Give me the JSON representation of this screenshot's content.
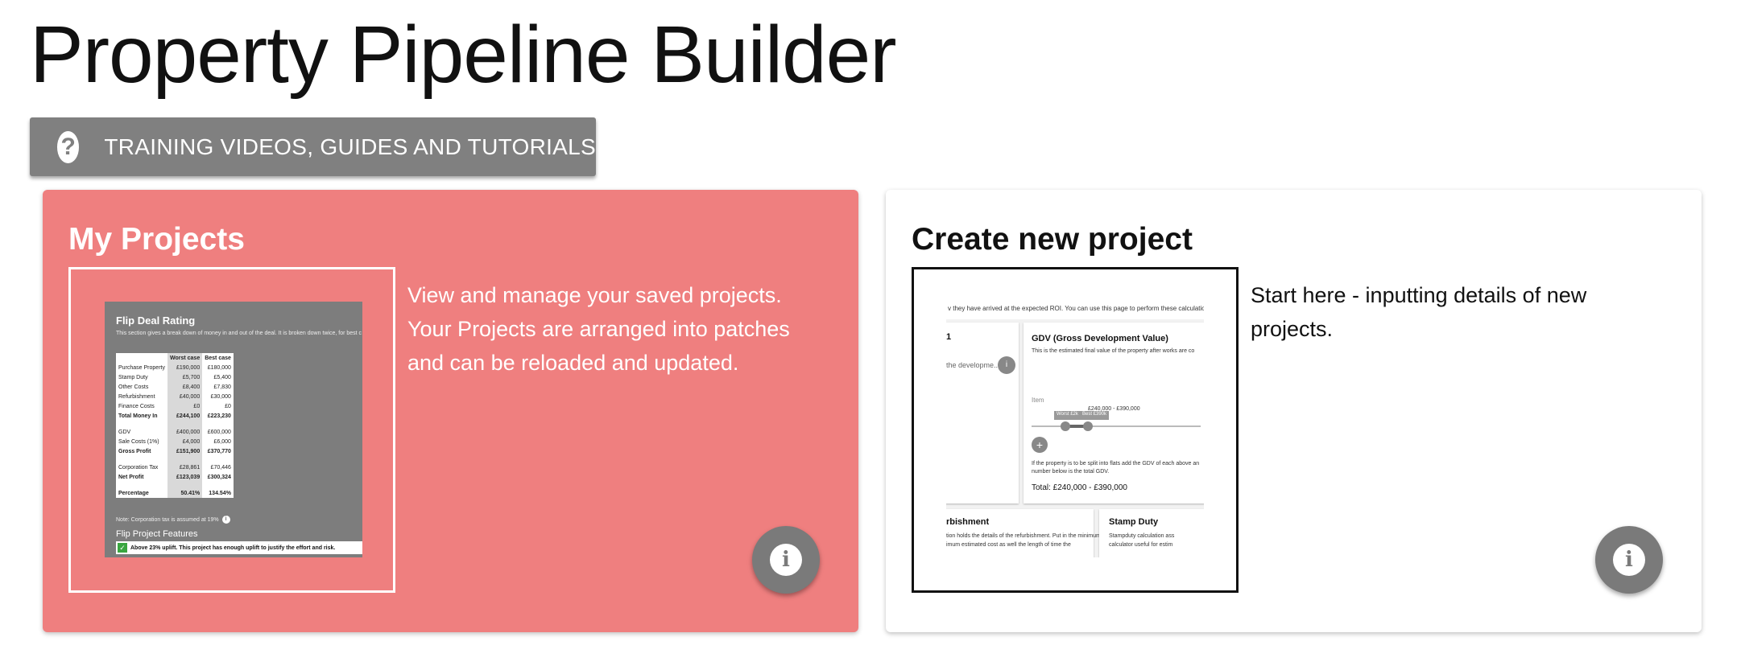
{
  "page": {
    "title": "Property Pipeline Builder"
  },
  "training": {
    "label": "TRAINING VIDEOS, GUIDES AND TUTORIALS",
    "icon": "question-icon"
  },
  "cards": {
    "projects": {
      "title": "My Projects",
      "description": "View and manage your saved projects. Your Projects are arranged into patches and can be reloaded and updated.",
      "accent": "#ef7f7f",
      "thumbnail": {
        "heading": "Flip Deal Rating",
        "subheading": "This section gives a break down of money in and out of the deal. It is broken down twice, for best c",
        "col_worst": "Worst case",
        "col_best": "Best case",
        "rows": [
          {
            "label": "Purchase Property",
            "worst": "£190,000",
            "best": "£180,000",
            "bold": false
          },
          {
            "label": "Stamp Duty",
            "worst": "£5,700",
            "best": "£5,400",
            "bold": false
          },
          {
            "label": "Other Costs",
            "worst": "£8,400",
            "best": "£7,830",
            "bold": false
          },
          {
            "label": "Refurbishment",
            "worst": "£40,000",
            "best": "£30,000",
            "bold": false
          },
          {
            "label": "Finance Costs",
            "worst": "£0",
            "best": "£0",
            "bold": false
          },
          {
            "label": "Total Money In",
            "worst": "£244,100",
            "best": "£223,230",
            "bold": true
          },
          {
            "gap": true
          },
          {
            "label": "GDV",
            "worst": "£400,000",
            "best": "£600,000",
            "bold": false
          },
          {
            "label": "Sale Costs (1%)",
            "worst": "£4,000",
            "best": "£6,000",
            "bold": false
          },
          {
            "label": "Gross Profit",
            "worst": "£151,900",
            "best": "£370,770",
            "bold": true
          },
          {
            "gap": true
          },
          {
            "label": "Corporation Tax",
            "worst": "£28,861",
            "best": "£70,446",
            "bold": false
          },
          {
            "label": "Net Profit",
            "worst": "£123,039",
            "best": "£300,324",
            "bold": true
          },
          {
            "gap": true
          },
          {
            "label": "Percentage",
            "worst": "50.41%",
            "best": "134.54%",
            "bold": true
          }
        ],
        "note": "Note: Corporation tax is assumed at 19%",
        "features_title": "Flip Project Features",
        "banner": "Above 23% uplift. This project has enough uplift to justify the effort and risk."
      }
    },
    "create": {
      "title": "Create new project",
      "description": "Start here - inputting details of new projects.",
      "thumbnail": {
        "top_text": "v they have arrived at the expected ROI. You can use this page to perform these calculations.",
        "left_caption": "1",
        "left_input": "the developme...",
        "gdv_title": "GDV (Gross Development Value)",
        "gdv_sub": "This is the estimated final value of the property after works are co",
        "item_label": "Item",
        "range_text": "£240,000 - £390,000",
        "tip_worst": "Worst £2k",
        "tip_best": "Best £390k",
        "flats_text_1": "If the property is to be split into flats add the GDV of each above an",
        "flats_text_2": "number below is the total GDV.",
        "total": "Total: £240,000 - £390,000",
        "refurb_title": "rbishment",
        "refurb_l1": "tion holds the details of the refurbishment. Put in the minimum",
        "refurb_l2": "imum estimated cost as well the length of time the",
        "stamp_title": "Stamp Duty",
        "stamp_l1": "Stampduty calculation ass",
        "stamp_l2": "calculator useful for estim"
      }
    }
  },
  "info_icon": "info-icon"
}
